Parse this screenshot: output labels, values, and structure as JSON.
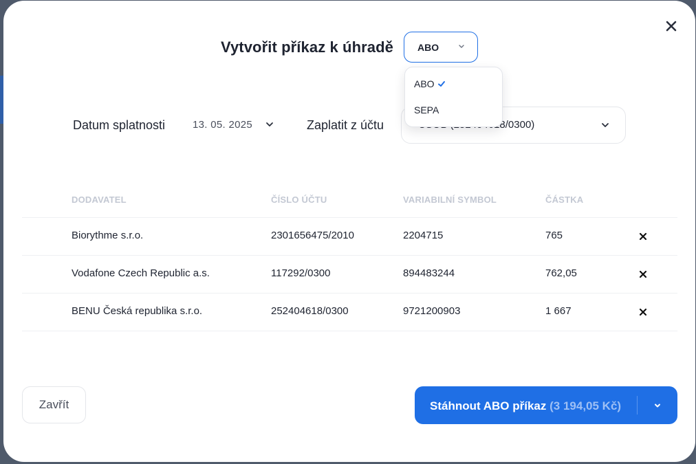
{
  "modal": {
    "title": "Vytvořit příkaz k úhradě",
    "format_select": {
      "value": "ABO"
    },
    "format_options": [
      {
        "label": "ABO",
        "selected": true
      },
      {
        "label": "SEPA",
        "selected": false
      }
    ],
    "due_date": {
      "label": "Datum splatnosti",
      "value": "13. 05. 2025"
    },
    "pay_from": {
      "label": "Zaplatit z účtu",
      "value": "CSOB (252404618/0300)"
    },
    "table": {
      "headers": [
        "DODAVATEL",
        "ČÍSLO ÚČTU",
        "VARIABILNÍ SYMBOL",
        "ČÁSTKA"
      ],
      "rows": [
        {
          "supplier": "Biorythme s.r.o.",
          "account": "2301656475/2010",
          "vs": "2204715",
          "amount": "765"
        },
        {
          "supplier": "Vodafone Czech Republic a.s.",
          "account": "117292/0300",
          "vs": "894483244",
          "amount": "762,05"
        },
        {
          "supplier": "BENU Česká republika s.r.o.",
          "account": "252404618/0300",
          "vs": "9721200903",
          "amount": "1 667"
        }
      ]
    },
    "footer": {
      "close_label": "Zavřít",
      "download_label": "Stáhnout ABO příkaz",
      "download_amount": "(3 194,05 Kč)"
    }
  },
  "colors": {
    "accent": "#1f6fe5",
    "text": "#1e2330",
    "header_text": "#c3c8d3"
  },
  "icons": {
    "close": "close-icon",
    "chevron": "chevron-down-icon",
    "check": "check-icon",
    "remove": "remove-row-icon"
  }
}
